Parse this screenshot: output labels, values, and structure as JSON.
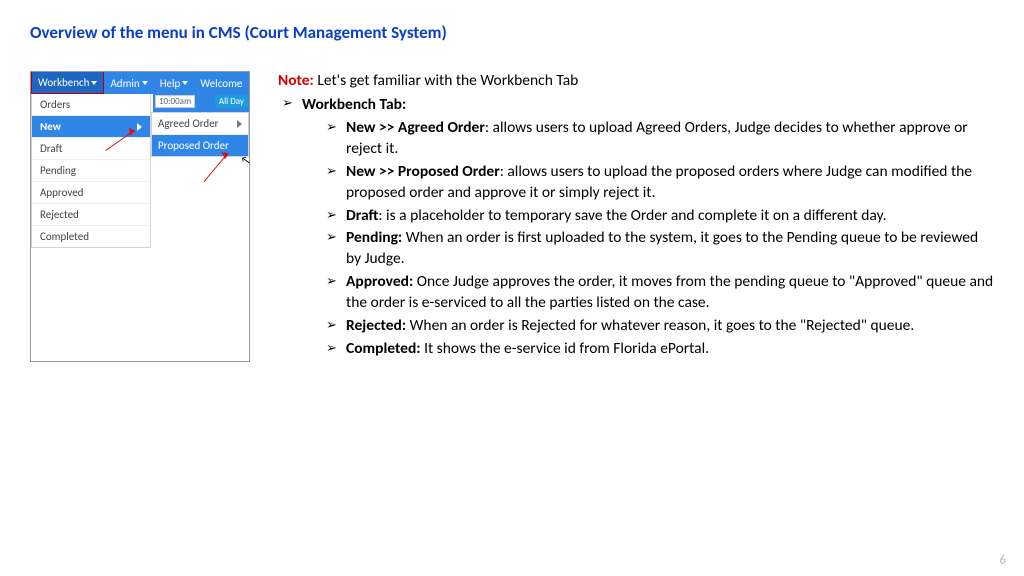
{
  "title": "Overview of the menu in CMS (Court Management System)",
  "note": {
    "label": "Note:",
    "text": " Let's get familiar with the Workbench Tab"
  },
  "l1": {
    "heading": "Workbench Tab:"
  },
  "items": [
    {
      "bold": "New >> Agreed Order",
      "rest": ": allows users to upload Agreed Orders, Judge decides to whether approve or reject it."
    },
    {
      "bold": "New >> Proposed Order",
      "rest": ": allows users to upload the proposed orders where Judge can modified the proposed order and approve it or simply reject it."
    },
    {
      "bold": "Draft",
      "rest": ": is a placeholder to temporary save the Order and complete it on a different day."
    },
    {
      "bold": "Pending:",
      "rest": " When an order is first uploaded to the system, it goes to the Pending queue to be reviewed by Judge."
    },
    {
      "bold": "Approved:",
      "rest": " Once Judge approves the order, it moves from the pending queue to \"Approved\" queue and the order is e-serviced to all the parties listed on the case."
    },
    {
      "bold": "Rejected:",
      "rest": " When an order is Rejected for whatever reason, it goes to the \"Rejected\" queue."
    },
    {
      "bold": "Completed:",
      "rest": " It shows the e-service id from Florida ePortal."
    }
  ],
  "menubar": {
    "workbench": "Workbench",
    "admin": "Admin",
    "help": "Help",
    "welcome": "Welcome"
  },
  "drop": [
    "Orders",
    "New",
    "Draft",
    "Pending",
    "Approved",
    "Rejected",
    "Completed"
  ],
  "sub": [
    "Agreed Order",
    "Proposed Order"
  ],
  "bgtime": "10:00am",
  "bgbtn": "All Day",
  "page": "6"
}
